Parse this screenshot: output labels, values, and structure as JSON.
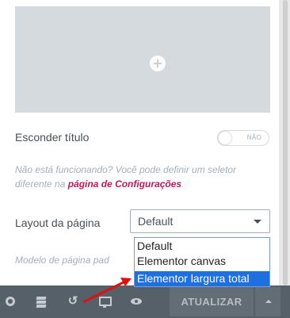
{
  "settings": {
    "hide_title": {
      "label": "Esconder título",
      "toggle_text": "NÃO"
    },
    "note": {
      "prefix": "Não está funcionando? Você pode definir um seletor diferente na ",
      "link": "página de Configurações",
      "suffix": "."
    },
    "page_layout": {
      "label": "Layout da página",
      "selected": "Default",
      "options": [
        "Default",
        "Elementor canvas",
        "Elementor largura total"
      ],
      "highlighted": "Elementor largura total",
      "model_note": "Modelo de página pad"
    }
  },
  "footer": {
    "icons": [
      "gear-icon",
      "layers-icon",
      "history-icon",
      "desktop-icon",
      "eye-icon"
    ],
    "update_label": "ATUALIZAR",
    "arrow_icon": "caret-up-icon"
  },
  "colors": {
    "footer_bg": "#556068",
    "highlight": "#1e6fe0",
    "link": "#c2185b",
    "annotation_arrow": "#e01010"
  }
}
